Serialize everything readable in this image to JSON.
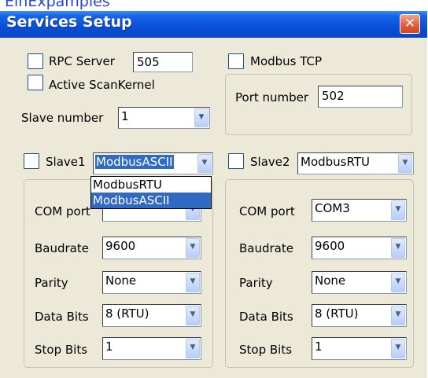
{
  "top_banner": "E­in­­Exp­amples",
  "window": {
    "title": "Services Setup",
    "close_glyph": "✕"
  },
  "rpc": {
    "label": "RPC Server",
    "value": "505",
    "checked": false
  },
  "modbus_tcp": {
    "label": "Modbus TCP",
    "checked": false,
    "port_label": "Port number",
    "port_value": "502"
  },
  "active_scankernel": {
    "label": "Active ScanKernel",
    "checked": false
  },
  "slave_number": {
    "label": "Slave number",
    "value": "1"
  },
  "slave1": {
    "label": "Slave1",
    "checked": false,
    "protocol": "ModbusASCII",
    "dropdown_open": true,
    "options": [
      "ModbusRTU",
      "ModbusASCII"
    ],
    "highlighted_option": "ModbusASCII",
    "fields": {
      "com_port": {
        "label": "COM port",
        "value": ""
      },
      "baudrate": {
        "label": "Baudrate",
        "value": "9600"
      },
      "parity": {
        "label": "Parity",
        "value": "None"
      },
      "data_bits": {
        "label": "Data Bits",
        "value": "8 (RTU)"
      },
      "stop_bits": {
        "label": "Stop Bits",
        "value": "1"
      }
    }
  },
  "slave2": {
    "label": "Slave2",
    "checked": false,
    "protocol": "ModbusRTU",
    "fields": {
      "com_port": {
        "label": "COM port",
        "value": "COM3"
      },
      "baudrate": {
        "label": "Baudrate",
        "value": "9600"
      },
      "parity": {
        "label": "Parity",
        "value": "None"
      },
      "data_bits": {
        "label": "Data Bits",
        "value": "8 (RTU)"
      },
      "stop_bits": {
        "label": "Stop Bits",
        "value": "1"
      }
    }
  },
  "icons": {
    "dropdown_arrow": "chevron-down-icon",
    "close": "close-icon"
  },
  "colors": {
    "titlebar": "#0a4fd7",
    "dialog_bg": "#ece9d8",
    "selection": "#316ac5",
    "close_button": "#e15a37"
  }
}
